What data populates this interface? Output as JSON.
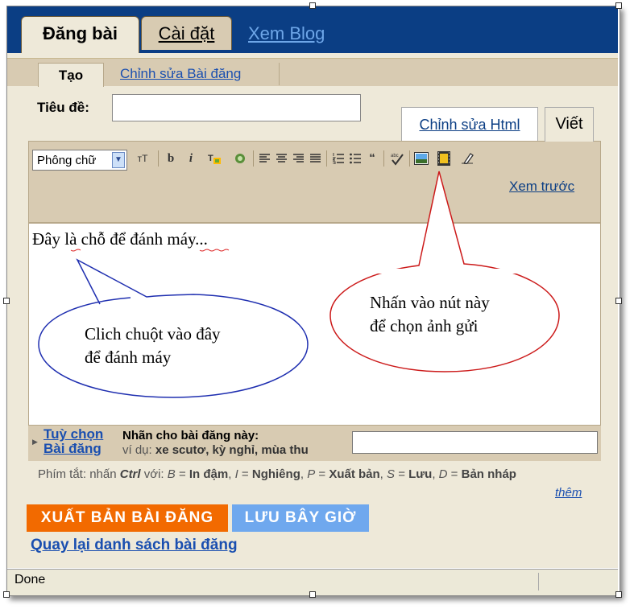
{
  "tabs": {
    "post": "Đăng bài",
    "settings": "Cài đặt",
    "view_blog": "Xem Blog"
  },
  "subtabs": {
    "create": "Tạo",
    "edit_posts": "Chỉnh sửa Bài đăng"
  },
  "title_field": {
    "label": "Tiêu đề:",
    "value": ""
  },
  "editor_modes": {
    "html": "Chỉnh sửa Html",
    "compose": "Viết"
  },
  "toolbar": {
    "font_select": "Phông chữ",
    "icons": [
      "font-size-icon",
      "bold-icon",
      "italic-icon",
      "text-color-icon",
      "link-icon",
      "align-left-icon",
      "align-center-icon",
      "align-right-icon",
      "justify-icon",
      "numbered-list-icon",
      "bullet-list-icon",
      "blockquote-icon",
      "spellcheck-icon",
      "add-image-icon",
      "add-video-icon",
      "clear-formatting-icon"
    ],
    "bold": "b",
    "italic": "i",
    "font_size": "тT",
    "preview": "Xem trước"
  },
  "editor": {
    "content": "Đây là chỗ để đánh máy..."
  },
  "callouts": {
    "click_here": [
      "Clich chuột vào đây",
      "để đánh máy"
    ],
    "image_button": [
      "Nhấn vào nút này",
      "để chọn ảnh gửi"
    ]
  },
  "labels": {
    "link_line1": "Tuỳ chọn",
    "link_line2": "Bài đăng",
    "title": "Nhãn cho bài đăng này:",
    "example_prefix": "ví dụ:",
    "example_values": "xe scutơ, kỳ nghỉ, mùa thu",
    "value": ""
  },
  "shortcuts": {
    "prefix": "Phím tắt: nhấn",
    "ctrl": "Ctrl",
    "with": "với:",
    "items": [
      {
        "key": "B",
        "label": "In đậm"
      },
      {
        "key": "I",
        "label": "Nghiêng"
      },
      {
        "key": "P",
        "label": "Xuất bản"
      },
      {
        "key": "S",
        "label": "Lưu"
      },
      {
        "key": "D",
        "label": "Bản nháp"
      }
    ],
    "more": "thêm"
  },
  "buttons": {
    "publish": "XUẤT BẢN BÀI ĐĂNG",
    "save_now": "LƯU BÂY GIỜ"
  },
  "back_link": "Quay lại danh sách bài đăng",
  "status": "Done",
  "colors": {
    "header_bg": "#0b3e84",
    "panel_bg": "#eee9d9",
    "toolbar_bg": "#d8cbb2",
    "publish": "#f26a00",
    "save": "#6fa8ee",
    "callout_blue": "#1f2fb0",
    "callout_red": "#cc1a1a"
  }
}
